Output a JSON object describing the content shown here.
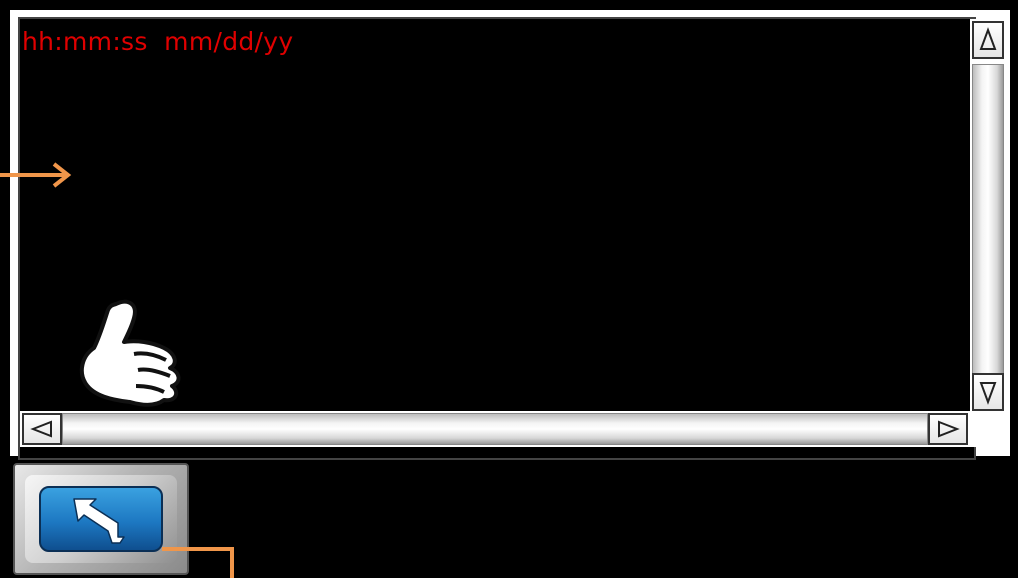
{
  "log_window": {
    "header": "hh:mm:ss  mm/dd/yy"
  },
  "scrollbar": {
    "up_icon": "triangle-up-icon",
    "down_icon": "triangle-down-icon",
    "left_icon": "triangle-left-icon",
    "right_icon": "triangle-right-icon"
  },
  "back_button": {
    "icon": "return-arrow-icon"
  },
  "colors": {
    "header_text": "#e00000",
    "annotation": "#f0964a",
    "button_blue": "#1d78c2"
  }
}
